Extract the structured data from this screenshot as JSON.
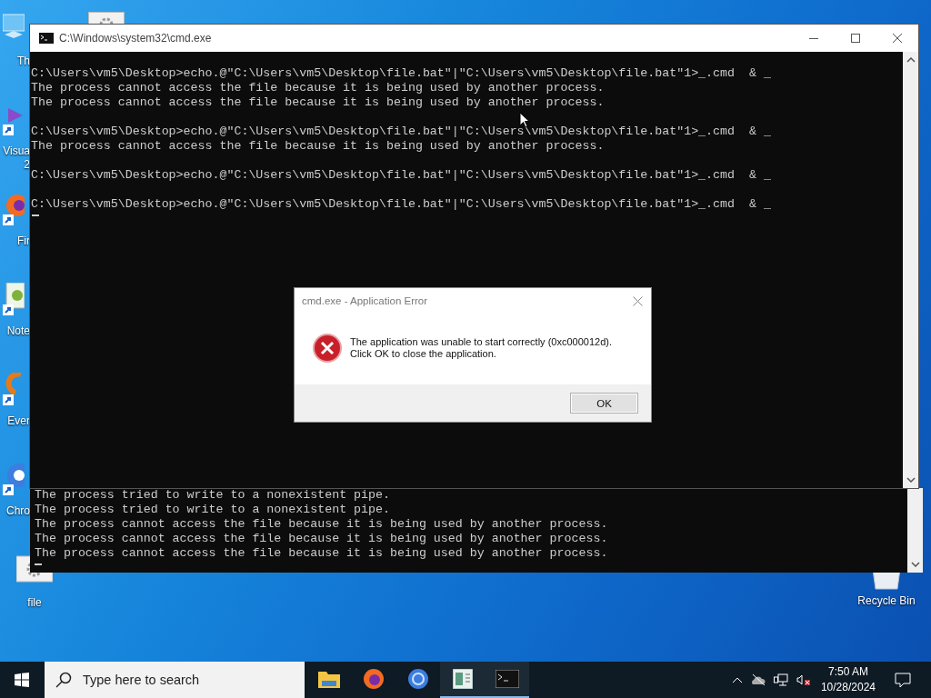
{
  "desktop_icons": [
    {
      "kind": "pc",
      "label": [
        "Th"
      ]
    },
    {
      "kind": "visual-studio",
      "label": [
        "Visua",
        "2"
      ]
    },
    {
      "kind": "firefox",
      "label": [
        "Fir"
      ]
    },
    {
      "kind": "notepad",
      "label": [
        "Note"
      ]
    },
    {
      "kind": "everything",
      "label": [
        "Ever"
      ]
    },
    {
      "kind": "chrome",
      "label": [
        "Chro"
      ]
    },
    {
      "kind": "file",
      "label": [
        "file"
      ]
    }
  ],
  "hidden_icon": {
    "kind": "file"
  },
  "recycle_bin": {
    "kind": "recycle-bin",
    "label": [
      "Recycle Bin"
    ]
  },
  "back_console": {
    "lines": [
      "The process tried to write to a nonexistent pipe.",
      "The process tried to write to a nonexistent pipe.",
      "The process cannot access the file because it is being used by another process.",
      "The process cannot access the file because it is being used by another process.",
      "The process cannot access the file because it is being used by another process."
    ]
  },
  "console_window": {
    "title": "C:\\Windows\\system32\\cmd.exe",
    "blocks": [
      [
        "C:\\Users\\vm5\\Desktop>echo.@\"C:\\Users\\vm5\\Desktop\\file.bat\"|\"C:\\Users\\vm5\\Desktop\\file.bat\"1>_.cmd  & _",
        "The process cannot access the file because it is being used by another process.",
        "The process cannot access the file because it is being used by another process."
      ],
      [
        "C:\\Users\\vm5\\Desktop>echo.@\"C:\\Users\\vm5\\Desktop\\file.bat\"|\"C:\\Users\\vm5\\Desktop\\file.bat\"1>_.cmd  & _",
        "The process cannot access the file because it is being used by another process."
      ],
      [
        "C:\\Users\\vm5\\Desktop>echo.@\"C:\\Users\\vm5\\Desktop\\file.bat\"|\"C:\\Users\\vm5\\Desktop\\file.bat\"1>_.cmd  & _"
      ],
      [
        "C:\\Users\\vm5\\Desktop>echo.@\"C:\\Users\\vm5\\Desktop\\file.bat\"|\"C:\\Users\\vm5\\Desktop\\file.bat\"1>_.cmd  & _"
      ]
    ]
  },
  "dialog": {
    "title": "cmd.exe - Application Error",
    "message": [
      "The application was unable to start correctly (0xc000012d).",
      "Click OK to close the application."
    ],
    "button": "OK"
  },
  "taskbar": {
    "search": {
      "placeholder": "Type here to search"
    },
    "apps": [
      {
        "kind": "folder",
        "running": false
      },
      {
        "kind": "firefox",
        "running": false
      },
      {
        "kind": "chrome",
        "running": false
      },
      {
        "kind": "notepad",
        "running": true
      },
      {
        "kind": "console",
        "running": true
      }
    ],
    "clock": {
      "time": "7:50 AM",
      "date": "10/28/2024"
    }
  }
}
